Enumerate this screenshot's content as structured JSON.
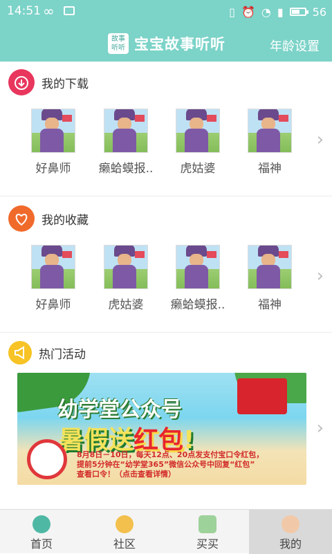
{
  "status_bar": {
    "time": "14:51",
    "battery": "56",
    "battery_level": 0.56
  },
  "app_bar": {
    "logo_text": "故事\n听听",
    "title": "宝宝故事听听",
    "age_setting": "年龄设置"
  },
  "downloads": {
    "label": "我的下载",
    "items": [
      {
        "label": "好鼻师"
      },
      {
        "label": "癞蛤蟆报.."
      },
      {
        "label": "虎姑婆"
      },
      {
        "label": "福神"
      }
    ]
  },
  "favorites": {
    "label": "我的收藏",
    "items": [
      {
        "label": "好鼻师"
      },
      {
        "label": "虎姑婆"
      },
      {
        "label": "癞蛤蟆报.."
      },
      {
        "label": "福神"
      }
    ]
  },
  "activities": {
    "label": "热门活动",
    "banner": {
      "title1": "幼学堂公众号",
      "title2a": "暑假送",
      "title2b": "红包",
      "title2c": "!",
      "line1": "8月8日－10日，每天12点、20点发支付宝口令红包，",
      "line2": "提前5分钟在“幼学堂365”微信公众号中回复“红包”",
      "line3": "查看口令！（点击查看详情）"
    }
  },
  "tabs": [
    {
      "label": "首页"
    },
    {
      "label": "社区"
    },
    {
      "label": "买买"
    },
    {
      "label": "我的"
    }
  ],
  "colors": {
    "accent": "#7cd3c8",
    "download_icon": "#e8365d",
    "favorite_icon": "#f06a2c",
    "activity_icon": "#f7c325"
  }
}
